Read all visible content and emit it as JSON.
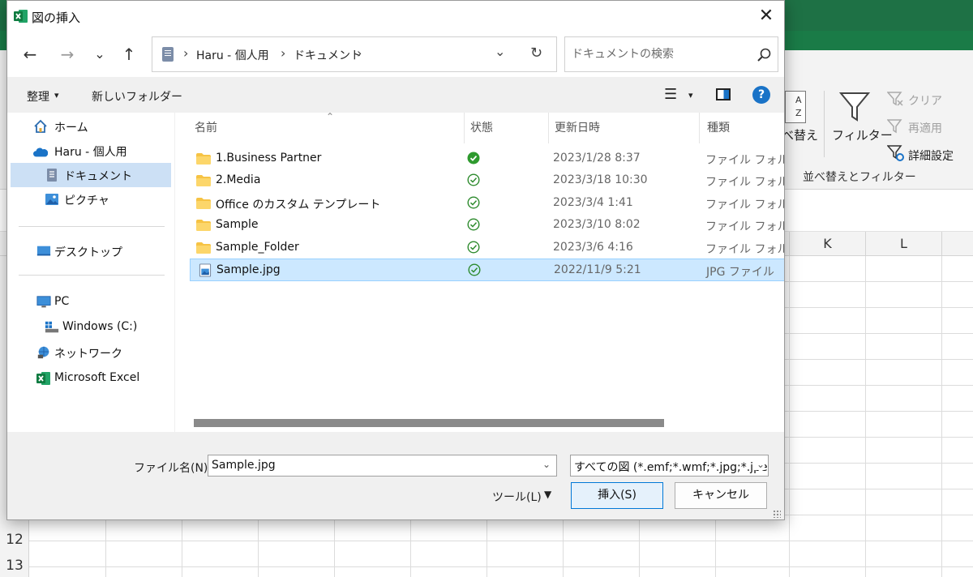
{
  "dialog": {
    "title": "図の挿入",
    "close_glyph": "✕",
    "address": {
      "crumbs": [
        "Haru - 個人用",
        "ドキュメント"
      ],
      "separator": "›",
      "dropdown_glyph": "⌄",
      "refresh_glyph": "↻"
    },
    "search": {
      "placeholder": "ドキュメントの検索"
    },
    "nav": {
      "back": "←",
      "forward": "→",
      "recent": "⌄",
      "up": "↑"
    },
    "toolbar": {
      "organize": "整理",
      "organize_arrow": "▾",
      "new_folder": "新しいフォルダー",
      "view_glyph": "☰",
      "view_arrow": "▾",
      "help": "?"
    },
    "sidebar": {
      "items": [
        {
          "label": "ホーム"
        },
        {
          "label": "Haru - 個人用"
        },
        {
          "label": "ドキュメント",
          "selected": true
        },
        {
          "label": "ピクチャ"
        },
        {
          "label": "デスクトップ"
        },
        {
          "label": "PC"
        },
        {
          "label": "Windows (C:)"
        },
        {
          "label": "ネットワーク"
        },
        {
          "label": "Microsoft Excel"
        }
      ]
    },
    "columns": {
      "name": "名前",
      "status": "状態",
      "modified": "更新日時",
      "type": "種類",
      "sort_glyph": "⌃"
    },
    "files": [
      {
        "name": "1.Business Partner",
        "date": "2023/1/28 8:37",
        "type": "ファイル フォルダー",
        "kind": "folder",
        "status": "synced-filled"
      },
      {
        "name": "2.Media",
        "date": "2023/3/18 10:30",
        "type": "ファイル フォルダー",
        "kind": "folder",
        "status": "synced"
      },
      {
        "name": "Office のカスタム テンプレート",
        "date": "2023/3/4 1:41",
        "type": "ファイル フォルダー",
        "kind": "folder",
        "status": "synced"
      },
      {
        "name": "Sample",
        "date": "2023/3/10 8:02",
        "type": "ファイル フォルダー",
        "kind": "folder",
        "status": "synced"
      },
      {
        "name": "Sample_Folder",
        "date": "2023/3/6 4:16",
        "type": "ファイル フォルダー",
        "kind": "folder",
        "status": "synced"
      },
      {
        "name": "Sample.jpg",
        "date": "2022/11/9 5:21",
        "type": "JPG ファイル",
        "kind": "image",
        "status": "synced",
        "selected": true
      }
    ],
    "bottom": {
      "filename_label": "ファイル名(N):",
      "filename_value": "Sample.jpg",
      "filename_arrow": "⌄",
      "filetype_value": "すべての図 (*.emf;*.wmf;*.jpg;*.jpeg;*.png",
      "filetype_arrow": "⌄",
      "tools_label": "ツール(L)",
      "tools_arrow": "▼",
      "insert_label": "挿入(S)",
      "cancel_label": "キャンセル"
    }
  },
  "excel": {
    "ribbon": {
      "sort_label": "べ替え",
      "filter_label": "フィルター",
      "clear_label": "クリア",
      "reapply_label": "再適用",
      "advanced_label": "詳細設定",
      "group_label": "並べ替えとフィルター"
    },
    "columns": [
      "K",
      "L"
    ],
    "rows": [
      "12",
      "13"
    ]
  },
  "colors": {
    "excel_green": "#1e7145",
    "selection": "#cce8ff",
    "accent": "#0078d7",
    "sync_green": "#2e8b2e"
  }
}
